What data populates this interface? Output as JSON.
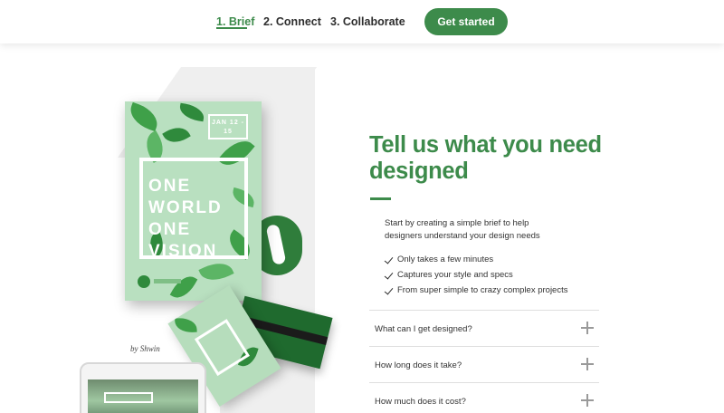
{
  "nav": {
    "steps": [
      {
        "label": "1. Brief",
        "active": true
      },
      {
        "label": "2. Connect",
        "active": false
      },
      {
        "label": "3. Collaborate",
        "active": false
      }
    ],
    "cta_label": "Get started"
  },
  "illustration": {
    "poster_date": "JAN 12 - 15",
    "poster_lines": [
      "ONE",
      "WORLD",
      "ONE",
      "VISION"
    ],
    "credit": "by Shwin"
  },
  "content": {
    "heading": "Tell us what you need designed",
    "intro": "Start by creating a simple brief to help designers understand your design needs",
    "bullets": [
      "Only takes a few minutes",
      "Captures your style and specs",
      "From super simple to crazy complex projects"
    ],
    "faq": [
      {
        "question": "What can I get designed?"
      },
      {
        "question": "How long does it take?"
      },
      {
        "question": "How much does it cost?"
      }
    ]
  },
  "colors": {
    "brand_green": "#3d8b4b",
    "text_dark": "#2b2b2b",
    "divider": "#dedede"
  },
  "icons": [
    "check-icon",
    "plus-icon"
  ]
}
